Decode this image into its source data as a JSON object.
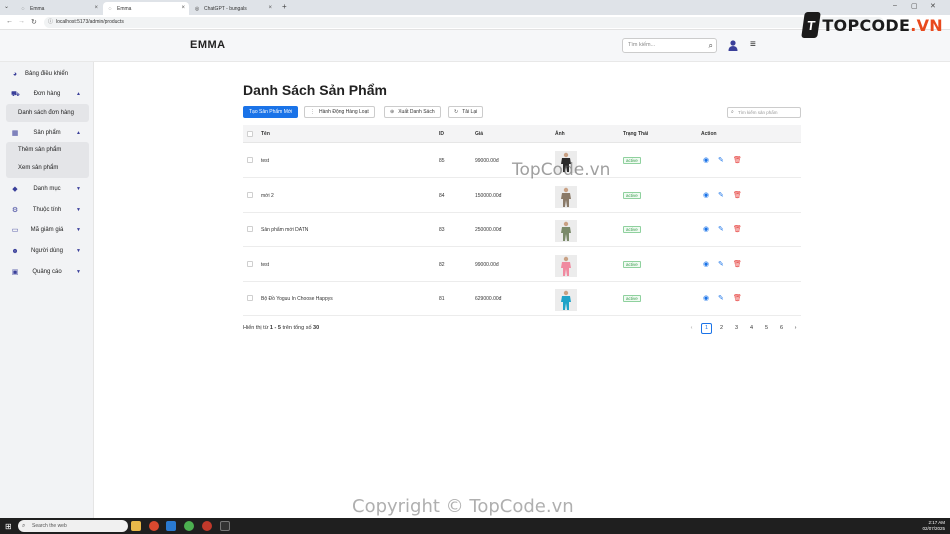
{
  "browser": {
    "tabs": [
      {
        "label": "Emma",
        "icon": "globe-icon"
      },
      {
        "label": "Emma",
        "icon": "globe-icon"
      },
      {
        "label": "ChatGPT - bungals",
        "icon": "chatgpt-icon"
      }
    ],
    "url": "localhost:5173/admin/products"
  },
  "logo": {
    "mark": "T",
    "text": "TOPCODE",
    "suffix": ".VN"
  },
  "header": {
    "brand": "EMMA",
    "search_placeholder": "Tìm kiếm..."
  },
  "sidebar": {
    "dashboard": "Bảng điều khiển",
    "orders": "Đơn hàng",
    "orders_sub": [
      "Danh sách đơn hàng"
    ],
    "products": "Sản phẩm",
    "products_sub": [
      "Thêm sản phẩm",
      "Xem sản phẩm"
    ],
    "categories": "Danh mục",
    "attributes": "Thuộc tính",
    "vouchers": "Mã giảm giá",
    "users": "Người dùng",
    "ads": "Quảng cáo"
  },
  "main": {
    "title": "Danh Sách Sản Phẩm",
    "buttons": {
      "create": "Tạo Sản Phẩm Mới",
      "bulk": "Hành Động Hàng Loạt",
      "export": "Xuất Danh Sách",
      "reload": "Tải Lại"
    },
    "table_search_placeholder": "Tìm kiếm sản phẩm",
    "columns": {
      "name": "Tên",
      "id": "ID",
      "price": "Giá",
      "image": "Ảnh",
      "status": "Trạng Thái",
      "action": "Action"
    },
    "rows": [
      {
        "name": "test",
        "id": "85",
        "price": "99000.00đ",
        "status": "active",
        "thumb_color": "#2b2b2b"
      },
      {
        "name": "mới 2",
        "id": "84",
        "price": "150000.00đ",
        "status": "active",
        "thumb_color": "#8a7a68"
      },
      {
        "name": "Sản phẩm mới DATN",
        "id": "83",
        "price": "250000.00đ",
        "status": "active",
        "thumb_color": "#7a8a6a"
      },
      {
        "name": "test",
        "id": "82",
        "price": "99000.00đ",
        "status": "active",
        "thumb_color": "#f08aa0"
      },
      {
        "name": "Bộ Đồ Yoguu In Choose Happys",
        "id": "81",
        "price": "629000.00đ",
        "status": "active",
        "thumb_color": "#1fa3c8"
      }
    ],
    "pagination": {
      "prefix": "Hiển thị từ",
      "range": "1 - 5",
      "middle": "trên tổng số",
      "total": "30",
      "pages": [
        "1",
        "2",
        "3",
        "4",
        "5",
        "6"
      ],
      "current": "1"
    }
  },
  "watermarks": {
    "center": "TopCode.vn",
    "bottom": "Copyright © TopCode.vn"
  },
  "taskbar": {
    "search_placeholder": "Search the web",
    "time": "2:17 AM",
    "date": "02/07/2025"
  }
}
